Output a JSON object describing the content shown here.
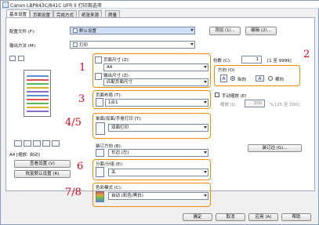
{
  "window": {
    "title": "Canon LBP843C/841C UFR II 打印首选项"
  },
  "tabs": [
    {
      "label": "基本设置"
    },
    {
      "label": "页面设置"
    },
    {
      "label": "完成方式"
    },
    {
      "label": "纸张来源"
    },
    {
      "label": "质量"
    }
  ],
  "profile": {
    "label": "配置文件 (F):",
    "value": "默认设置",
    "add": "添加 (1)...",
    "edit": "编辑 (2)..."
  },
  "output": {
    "label": "输出方法 (M):",
    "value": "打印"
  },
  "preview_info": "A4 [缩放: 自动]",
  "view_settings": "查看设置 (V)",
  "restore_defaults": "恢复默认设置 (R)",
  "page_size": {
    "label": "页面尺寸 (Z):",
    "value": "A4"
  },
  "output_size": {
    "label": "输出尺寸 (Z):",
    "value": "匹配页面尺寸"
  },
  "copies": {
    "label": "份数 (C):",
    "value": "1",
    "range": "[1 至 9999]"
  },
  "orientation": {
    "label": "方向 (O)",
    "portrait": "纵向",
    "landscape": "横向",
    "portrait_letter": "A",
    "landscape_letter": "A"
  },
  "page_layout": {
    "label": "页面布局 (T):",
    "value": "1合1"
  },
  "manual_scaling": {
    "label": "手动缩放 (E)",
    "scaling_label": "缩放 (I):",
    "value": "100",
    "range": "% [25 至 200]"
  },
  "print_style": {
    "label": "单面/双面/手册打印 (T):",
    "value": "双面打印"
  },
  "binding": {
    "label": "装订方向 (B):",
    "value": "长边 (左)",
    "gutter": "装订边 (G)..."
  },
  "collate": {
    "label": "分套/分组 (E):",
    "value": "关"
  },
  "color_mode": {
    "label": "色彩模式 (C):",
    "value": "自动 (彩色/黑白)"
  },
  "buttons": {
    "ok": "确定",
    "cancel": "取消",
    "apply": "应用 (A)",
    "help": "帮助"
  },
  "callouts": [
    "1",
    "2",
    "3",
    "4/5",
    "6",
    "7/8"
  ],
  "colors": {
    "accent": "#f08a00",
    "callout": "#e0001a"
  }
}
